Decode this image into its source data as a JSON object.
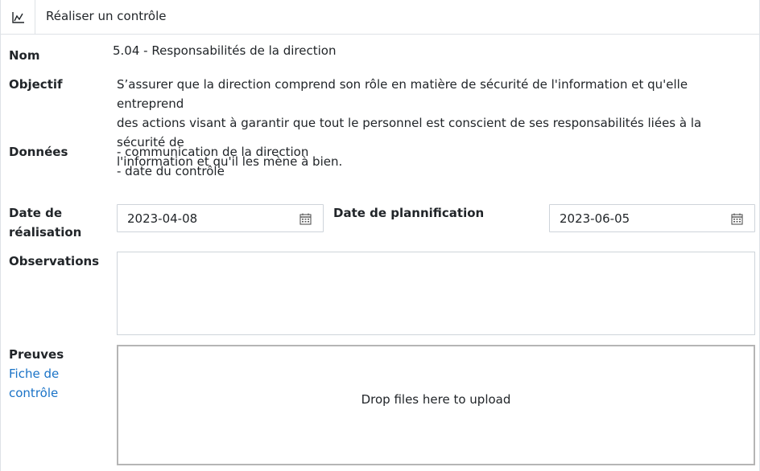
{
  "header": {
    "title": "Réaliser un contrôle",
    "icon": "chart-line-icon"
  },
  "fields": {
    "name_label": "Nom",
    "name_value": "5.04 - Responsabilités de la direction",
    "objective_label": "Objectif",
    "objective_line1": "S’assurer que la direction comprend son rôle en matière de sécurité de l'information et qu'elle entreprend",
    "objective_line2": "des actions visant à garantir que tout le personnel est conscient de ses responsabilités liées à la sécurité de",
    "objective_line3": "l'information et qu'il les mène à bien.",
    "data_label": "Données",
    "data_items": [
      "- communication de la direction",
      "- date du contrôle"
    ],
    "realisation_label_line1": "Date de",
    "realisation_label_line2": "réalisation",
    "realisation_date": "2023-04-08",
    "planification_label": "Date de plannification",
    "planification_date": "2023-06-05",
    "observations_label": "Observations",
    "observations_value": "",
    "proofs_label": "Preuves",
    "proofs_link_line1": "Fiche de",
    "proofs_link_line2": "contrôle",
    "dropzone_text": "Drop files here to upload"
  },
  "colors": {
    "link": "#1a73c7",
    "border": "#ced4da"
  }
}
